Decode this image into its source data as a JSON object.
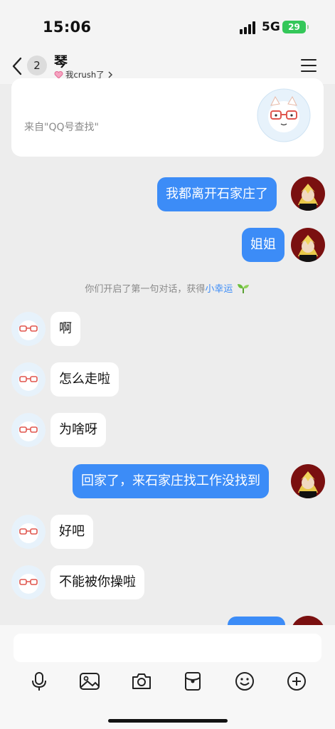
{
  "status": {
    "time": "15:06",
    "network": "5G",
    "battery": "29"
  },
  "header": {
    "unread_count": "2",
    "contact_name": "琴",
    "subtitle": "我crush了",
    "back_icon": "chevron-left-icon",
    "menu_icon": "menu-icon"
  },
  "card": {
    "source_text": "来自\"QQ号查找\""
  },
  "messages": [
    {
      "side": "right",
      "text": "我都离开石家庄了"
    },
    {
      "side": "right",
      "text": "姐姐"
    },
    {
      "side": "left",
      "text": "啊"
    },
    {
      "side": "left",
      "text": "怎么走啦"
    },
    {
      "side": "left",
      "text": "为啥呀"
    },
    {
      "side": "right",
      "text": "回家了，来石家庄找工作没找到"
    },
    {
      "side": "left",
      "text": "好吧"
    },
    {
      "side": "left",
      "text": "不能被你操啦"
    }
  ],
  "notice": {
    "text": "你们开启了第一句对话，获得",
    "link": "小幸运"
  },
  "toolbar": {
    "icons": [
      "microphone-icon",
      "image-icon",
      "camera-icon",
      "red-packet-icon",
      "emoji-icon",
      "plus-icon"
    ]
  },
  "colors": {
    "accent": "#3c8cf7",
    "background": "#ededed",
    "battery": "#34c759"
  }
}
